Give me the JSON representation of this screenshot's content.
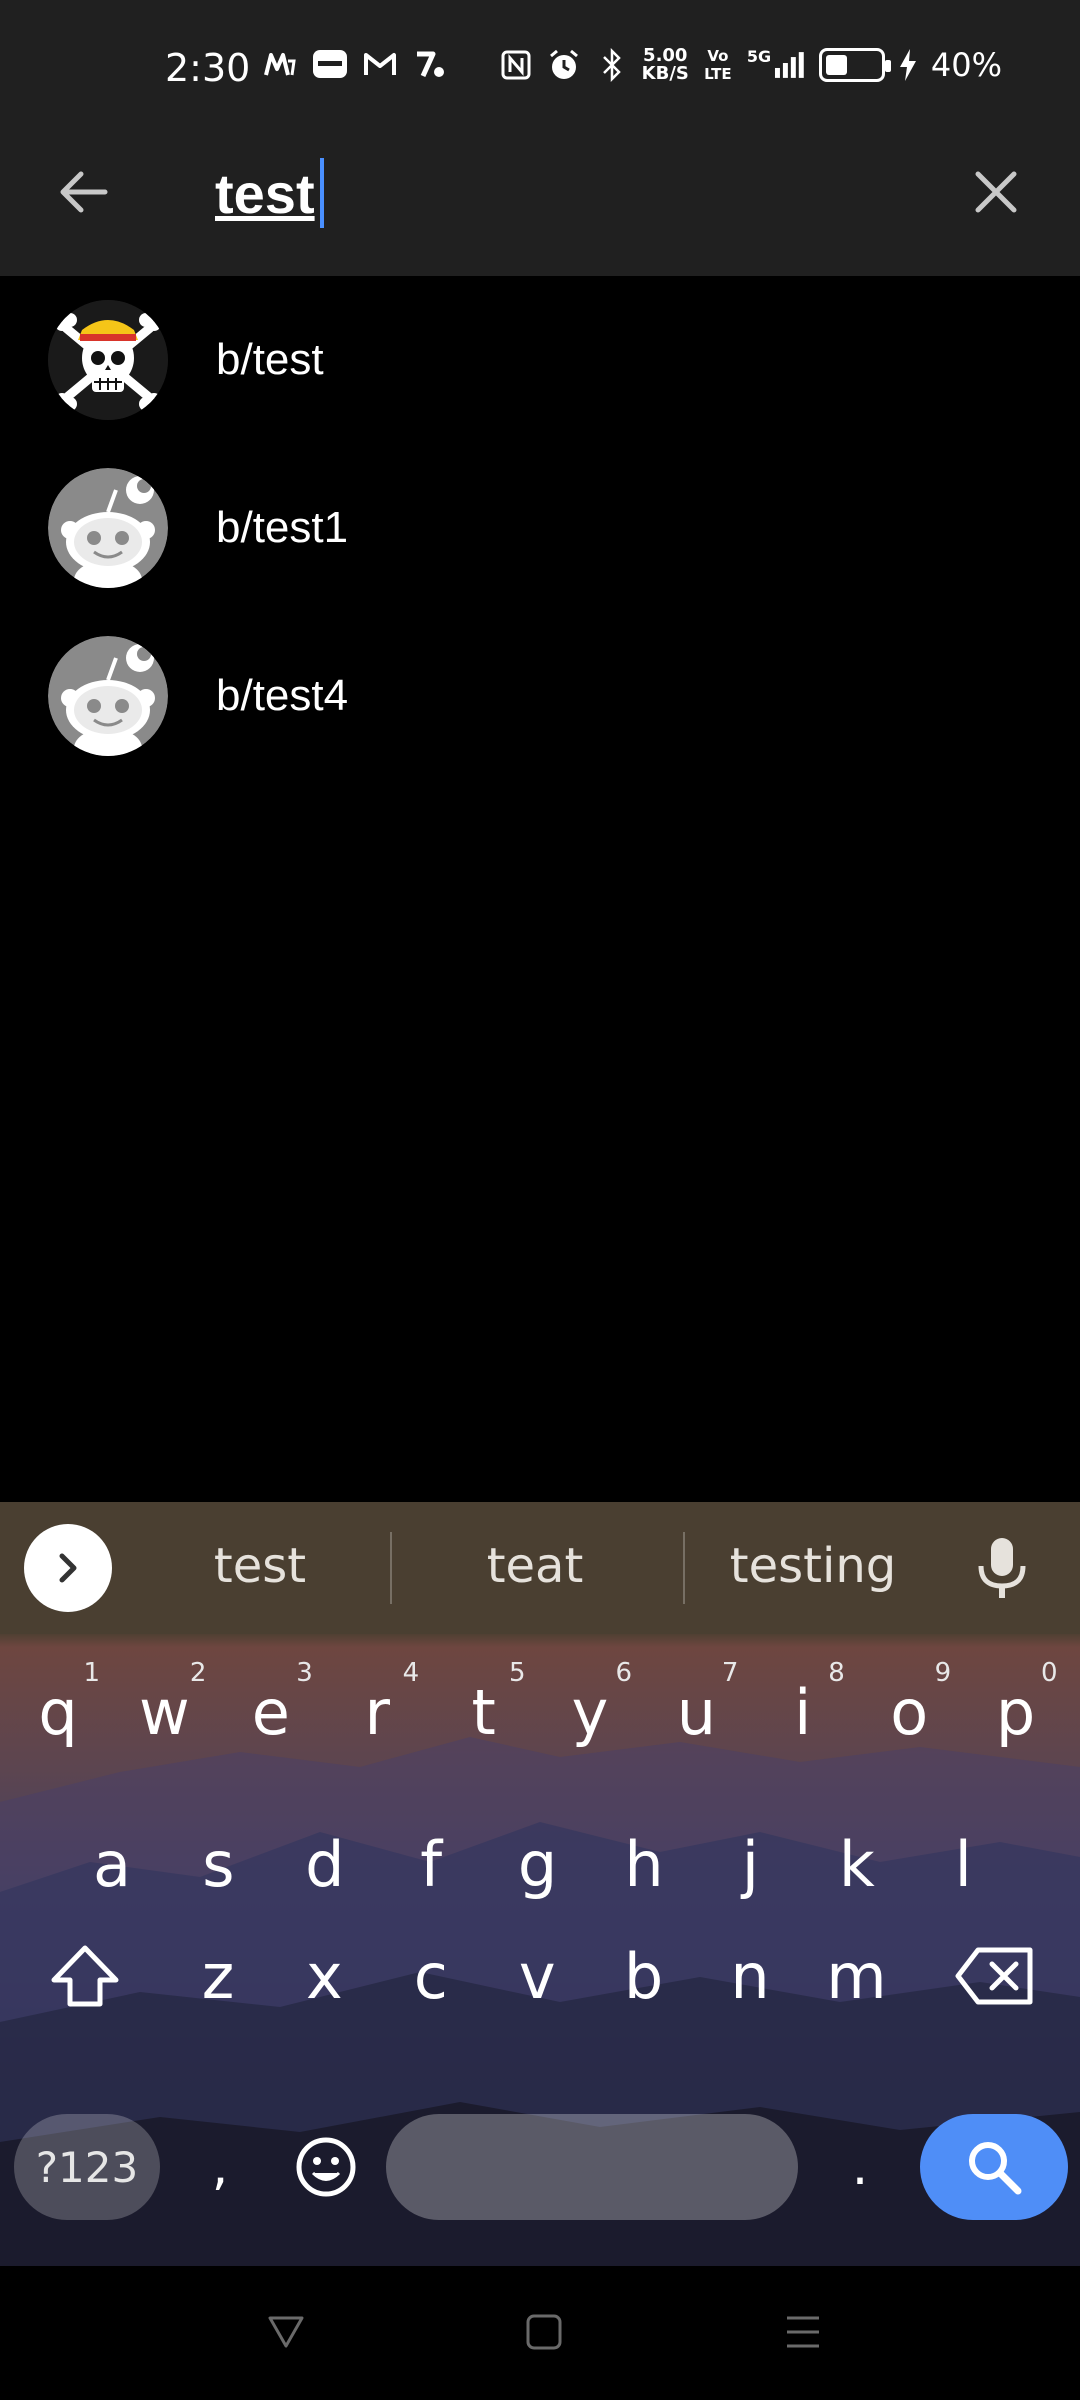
{
  "status_bar": {
    "time": "2:30",
    "net_speed_value": "5.00",
    "net_speed_unit": "KB/S",
    "volte": "Vo LTE",
    "network": "5G",
    "battery_percent": "40%",
    "battery_level": 0.4,
    "notification_icons": [
      "myntra-icon",
      "zomato-icon",
      "gmail-icon",
      "app-icon"
    ],
    "system_icons": [
      "nfc-icon",
      "alarm-icon",
      "bluetooth-icon",
      "signal-icon",
      "battery-icon",
      "charging-icon"
    ]
  },
  "search": {
    "query": "test",
    "back_icon": "arrow-left-icon",
    "clear_icon": "close-icon"
  },
  "results": [
    {
      "label": "b/test",
      "avatar": "jolly-roger-avatar"
    },
    {
      "label": "b/test1",
      "avatar": "default-snoo-avatar"
    },
    {
      "label": "b/test4",
      "avatar": "default-snoo-avatar"
    }
  ],
  "keyboard": {
    "suggestions": [
      "test",
      "teat",
      "testing"
    ],
    "row1": [
      {
        "k": "q",
        "h": "1"
      },
      {
        "k": "w",
        "h": "2"
      },
      {
        "k": "e",
        "h": "3"
      },
      {
        "k": "r",
        "h": "4"
      },
      {
        "k": "t",
        "h": "5"
      },
      {
        "k": "y",
        "h": "6"
      },
      {
        "k": "u",
        "h": "7"
      },
      {
        "k": "i",
        "h": "8"
      },
      {
        "k": "o",
        "h": "9"
      },
      {
        "k": "p",
        "h": "0"
      }
    ],
    "row2": [
      "a",
      "s",
      "d",
      "f",
      "g",
      "h",
      "j",
      "k",
      "l"
    ],
    "row3": [
      "z",
      "x",
      "c",
      "v",
      "b",
      "n",
      "m"
    ],
    "symbols_key": "?123",
    "comma_key": ",",
    "period_key": ".",
    "accent_color": "#4f8ef7"
  },
  "colors": {
    "top_bar": "#202020",
    "background": "#000000",
    "caret": "#4a90ff"
  }
}
